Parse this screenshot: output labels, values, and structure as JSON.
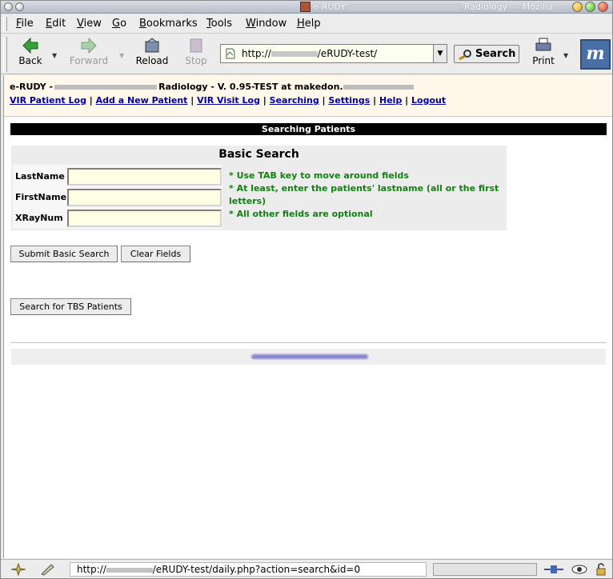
{
  "window": {
    "title_prefix": "e-RUDY",
    "title_suffix": "Radiology -",
    "title_app": "- Mozilla"
  },
  "menu": [
    "File",
    "Edit",
    "View",
    "Go",
    "Bookmarks",
    "Tools",
    "Window",
    "Help"
  ],
  "toolbar": {
    "back": "Back",
    "forward": "Forward",
    "reload": "Reload",
    "stop": "Stop",
    "url_prefix": "http://",
    "url_suffix": "/eRUDY-test/",
    "search": "Search",
    "print": "Print",
    "throbber": "m"
  },
  "app": {
    "title_prefix": "e-RUDY -",
    "title_middle": "Radiology - V. 0.95-TEST at makedon.",
    "nav": [
      "VIR Patient Log",
      "Add a New Patient",
      "VIR Visit Log",
      "Searching",
      "Settings",
      "Help",
      "Logout"
    ],
    "section_title": "Searching Patients"
  },
  "basic_search": {
    "heading": "Basic Search",
    "fields": [
      {
        "label": "LastName",
        "value": ""
      },
      {
        "label": "FirstName",
        "value": ""
      },
      {
        "label": "XRayNum",
        "value": ""
      }
    ],
    "hints": [
      "* Use TAB key to move around fields",
      "* At least, enter the patients' lastname (all or the first letters)",
      "* All other fields are optional"
    ],
    "submit": "Submit Basic Search",
    "clear": "Clear Fields",
    "tbs": "Search for TBS Patients"
  },
  "status": {
    "url_prefix": "http://",
    "url_suffix": "/eRUDY-test/daily.php?action=search&id=0"
  }
}
